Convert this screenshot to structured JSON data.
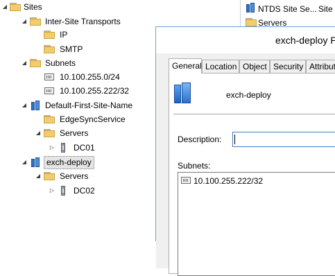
{
  "tree": {
    "items": [
      {
        "label": "Sites"
      },
      {
        "label": "Inter-Site Transports"
      },
      {
        "label": "IP"
      },
      {
        "label": "SMTP"
      },
      {
        "label": "Subnets"
      },
      {
        "label": "10.100.255.0/24"
      },
      {
        "label": "10.100.255.222/32"
      },
      {
        "label": "Default-First-Site-Name"
      },
      {
        "label": "EdgeSyncService"
      },
      {
        "label": "Servers"
      },
      {
        "label": "DC01"
      },
      {
        "label": "exch-deploy"
      },
      {
        "label": "Servers"
      },
      {
        "label": "DC02"
      }
    ]
  },
  "list": {
    "row1_name": "NTDS Site Se...",
    "row1_type": "Site",
    "row2_name": "Servers"
  },
  "dialog": {
    "title": "exch-deploy P",
    "tabs": [
      "General",
      "Location",
      "Object",
      "Security",
      "Attribut"
    ],
    "object_name": "exch-deploy",
    "description_label": "Description:",
    "description_value": "",
    "subnets_label": "Subnets:",
    "subnets": [
      "10.100.255.222/32"
    ]
  }
}
